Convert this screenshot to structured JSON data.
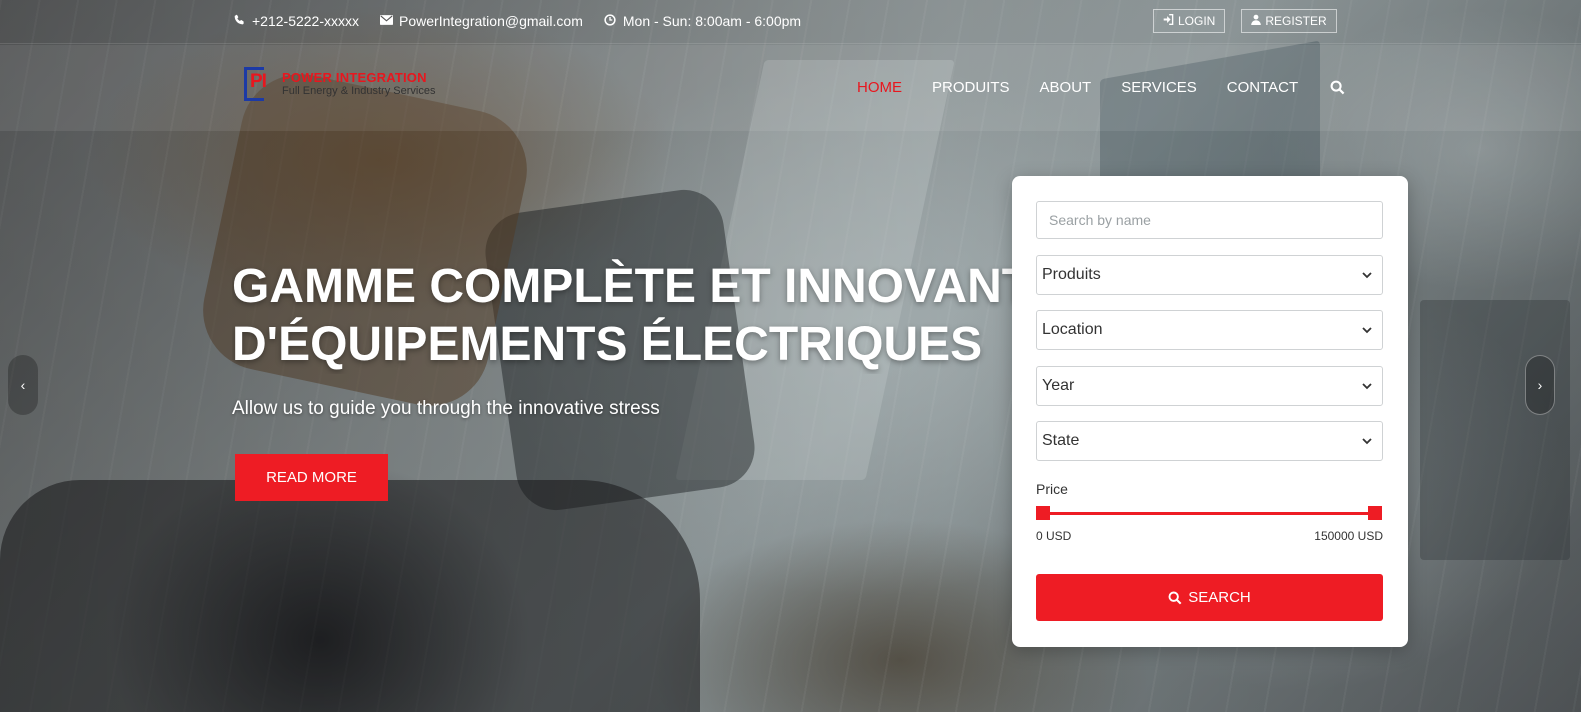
{
  "topbar": {
    "phone": "+212-5222-xxxxx",
    "email": "PowerIntegration@gmail.com",
    "hours": "Mon - Sun: 8:00am - 6:00pm",
    "login_label": "LOGIN",
    "register_label": "REGISTER",
    "icons": {
      "phone": "phone-icon",
      "email": "envelope-icon",
      "hours": "clock-icon",
      "login": "sign-in-icon",
      "register": "user-icon"
    }
  },
  "logo": {
    "mark": "PI",
    "name": "POWER INTEGRATION",
    "tagline": "Full Energy & Industry Services"
  },
  "nav": {
    "items": [
      {
        "label": "HOME",
        "active": true
      },
      {
        "label": "PRODUITS",
        "active": false
      },
      {
        "label": "ABOUT",
        "active": false
      },
      {
        "label": "SERVICES",
        "active": false
      },
      {
        "label": "CONTACT",
        "active": false
      }
    ],
    "search_icon": "search-icon"
  },
  "hero": {
    "title_line1": "GAMME COMPLÈTE ET INNOVANTE",
    "title_line2": "D'ÉQUIPEMENTS ÉLECTRIQUES",
    "subtitle": "Allow us to guide you through the innovative stress",
    "cta_label": "READ MORE",
    "arrow_left": "‹",
    "arrow_right": "›"
  },
  "search_form": {
    "name_placeholder": "Search by name",
    "name_value": "",
    "product_selected": "Produits",
    "location_selected": "Location",
    "year_selected": "Year",
    "state_selected": "State",
    "price_label": "Price",
    "price_min": "0 USD",
    "price_max": "150000 USD",
    "price_range_values": [
      0,
      150000
    ],
    "search_label": "SEARCH"
  },
  "colors": {
    "accent": "#ee1c24",
    "logo_blue": "#1c3aa6",
    "text_dark": "#333333",
    "white": "#ffffff"
  }
}
